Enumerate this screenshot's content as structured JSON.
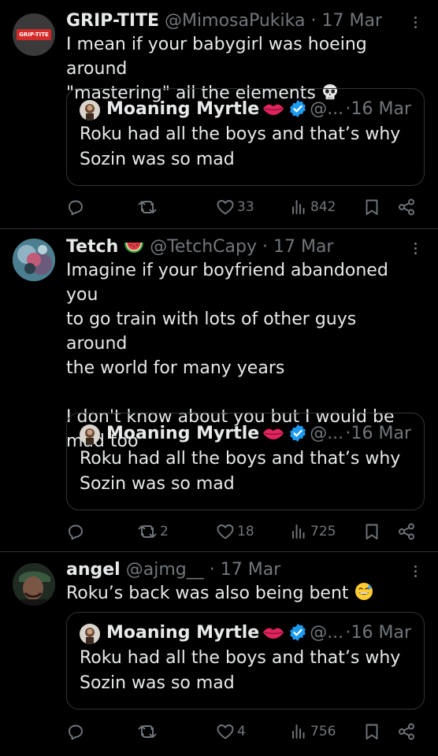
{
  "colors": {
    "background": "#000000",
    "text": "#e7e9ea",
    "muted": "#71767b",
    "border": "#2f3336",
    "verified": "#1d9bf0"
  },
  "quoted_tweet": {
    "name": "Moaning Myrtle",
    "handle": "@...",
    "separator": "·",
    "date": "16 Mar",
    "text": "Roku had all the boys and that’s why\nSozin was so mad"
  },
  "tweets": [
    {
      "avatar_text": "GRIP-TITE",
      "name": "GRIP-TITE",
      "handle": "@MimosaPukika",
      "separator": "·",
      "date": "17 Mar",
      "text": "I mean if your babygirl was hoeing around\n\"mastering\" all the elements",
      "emoji": "skull",
      "actions": {
        "reply": "",
        "repost": "",
        "like": "33",
        "views": "842"
      }
    },
    {
      "name": "Tetch",
      "name_emoji": "watermelon",
      "handle": "@TetchCapy",
      "separator": "·",
      "date": "17 Mar",
      "text": "Imagine if your boyfriend abandoned you\nto go train with lots of other guys around\nthe world for many years\n\nI don't know about you but I would be\nmad too",
      "actions": {
        "reply": "",
        "repost": "2",
        "like": "18",
        "views": "725"
      }
    },
    {
      "name": "angel",
      "handle": "@ajmg__",
      "separator": "·",
      "date": "17 Mar",
      "text": "Roku’s back was also being bent",
      "emoji": "grinning-sweat",
      "actions": {
        "reply": "",
        "repost": "",
        "like": "4",
        "views": "756"
      }
    }
  ]
}
